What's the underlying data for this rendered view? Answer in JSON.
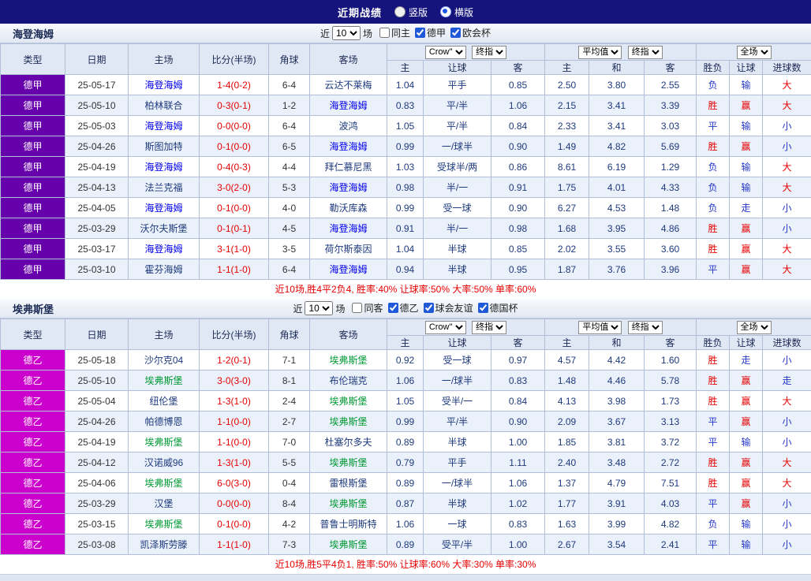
{
  "topbar": {
    "title": "近期战绩",
    "radios": [
      {
        "label": "竖版",
        "selected": false
      },
      {
        "label": "横版",
        "selected": true
      }
    ]
  },
  "labels": {
    "near": "近",
    "games": "场"
  },
  "columns": [
    "类型",
    "日期",
    "主场",
    "比分(半场)",
    "角球",
    "客场",
    "主",
    "让球",
    "客",
    "主",
    "和",
    "客",
    "胜负",
    "让球",
    "进球数"
  ],
  "selects": {
    "company": "Crow\"",
    "final_index": "终指",
    "average": "平均值",
    "scope": "全场"
  },
  "sections": [
    {
      "team": "海登海姆",
      "team_color": "#0000ee",
      "league_color": "#6600aa",
      "games_count": "10",
      "filters": [
        {
          "label": "同主",
          "checked": false
        },
        {
          "label": "德甲",
          "checked": true
        },
        {
          "label": "欧会杯",
          "checked": true
        }
      ],
      "rows": [
        {
          "league": "德甲",
          "date": "25-05-17",
          "home": "海登海姆",
          "focus": "home",
          "score": "1-4(0-2)",
          "corners": "6-4",
          "away": "云达不莱梅",
          "ah_home": "1.04",
          "ah_line": "平手",
          "ah_away": "0.85",
          "eu_home": "2.50",
          "eu_draw": "3.80",
          "eu_away": "2.55",
          "outcome": "负",
          "outcome_red": false,
          "ah_result": "输",
          "ah_result_red": false,
          "ou_result": "大",
          "ou_result_red": true
        },
        {
          "league": "德甲",
          "date": "25-05-10",
          "home": "柏林联合",
          "focus": "away",
          "score": "0-3(0-1)",
          "corners": "1-2",
          "away": "海登海姆",
          "ah_home": "0.83",
          "ah_line": "平/半",
          "ah_away": "1.06",
          "eu_home": "2.15",
          "eu_draw": "3.41",
          "eu_away": "3.39",
          "outcome": "胜",
          "outcome_red": true,
          "ah_result": "赢",
          "ah_result_red": true,
          "ou_result": "大",
          "ou_result_red": true
        },
        {
          "league": "德甲",
          "date": "25-05-03",
          "home": "海登海姆",
          "focus": "home",
          "score": "0-0(0-0)",
          "corners": "6-4",
          "away": "波鸿",
          "ah_home": "1.05",
          "ah_line": "平/半",
          "ah_away": "0.84",
          "eu_home": "2.33",
          "eu_draw": "3.41",
          "eu_away": "3.03",
          "outcome": "平",
          "outcome_red": false,
          "ah_result": "输",
          "ah_result_red": false,
          "ou_result": "小",
          "ou_result_red": false
        },
        {
          "league": "德甲",
          "date": "25-04-26",
          "home": "斯图加特",
          "focus": "away",
          "score": "0-1(0-0)",
          "corners": "6-5",
          "away": "海登海姆",
          "ah_home": "0.99",
          "ah_line": "一/球半",
          "ah_away": "0.90",
          "eu_home": "1.49",
          "eu_draw": "4.82",
          "eu_away": "5.69",
          "outcome": "胜",
          "outcome_red": true,
          "ah_result": "赢",
          "ah_result_red": true,
          "ou_result": "小",
          "ou_result_red": false
        },
        {
          "league": "德甲",
          "date": "25-04-19",
          "home": "海登海姆",
          "focus": "home",
          "score": "0-4(0-3)",
          "corners": "4-4",
          "away": "拜仁慕尼黑",
          "ah_home": "1.03",
          "ah_line": "受球半/两",
          "ah_away": "0.86",
          "eu_home": "8.61",
          "eu_draw": "6.19",
          "eu_away": "1.29",
          "outcome": "负",
          "outcome_red": false,
          "ah_result": "输",
          "ah_result_red": false,
          "ou_result": "大",
          "ou_result_red": true
        },
        {
          "league": "德甲",
          "date": "25-04-13",
          "home": "法兰克福",
          "focus": "away",
          "score": "3-0(2-0)",
          "corners": "5-3",
          "away": "海登海姆",
          "ah_home": "0.98",
          "ah_line": "半/一",
          "ah_away": "0.91",
          "eu_home": "1.75",
          "eu_draw": "4.01",
          "eu_away": "4.33",
          "outcome": "负",
          "outcome_red": false,
          "ah_result": "输",
          "ah_result_red": false,
          "ou_result": "大",
          "ou_result_red": true
        },
        {
          "league": "德甲",
          "date": "25-04-05",
          "home": "海登海姆",
          "focus": "home",
          "score": "0-1(0-0)",
          "corners": "4-0",
          "away": "勒沃库森",
          "ah_home": "0.99",
          "ah_line": "受一球",
          "ah_away": "0.90",
          "eu_home": "6.27",
          "eu_draw": "4.53",
          "eu_away": "1.48",
          "outcome": "负",
          "outcome_red": false,
          "ah_result": "走",
          "ah_result_red": false,
          "ou_result": "小",
          "ou_result_red": false
        },
        {
          "league": "德甲",
          "date": "25-03-29",
          "home": "沃尔夫斯堡",
          "focus": "away",
          "score": "0-1(0-1)",
          "corners": "4-5",
          "away": "海登海姆",
          "ah_home": "0.91",
          "ah_line": "半/一",
          "ah_away": "0.98",
          "eu_home": "1.68",
          "eu_draw": "3.95",
          "eu_away": "4.86",
          "outcome": "胜",
          "outcome_red": true,
          "ah_result": "赢",
          "ah_result_red": true,
          "ou_result": "小",
          "ou_result_red": false
        },
        {
          "league": "德甲",
          "date": "25-03-17",
          "home": "海登海姆",
          "focus": "home",
          "score": "3-1(1-0)",
          "corners": "3-5",
          "away": "荷尔斯泰因",
          "ah_home": "1.04",
          "ah_line": "半球",
          "ah_away": "0.85",
          "eu_home": "2.02",
          "eu_draw": "3.55",
          "eu_away": "3.60",
          "outcome": "胜",
          "outcome_red": true,
          "ah_result": "赢",
          "ah_result_red": true,
          "ou_result": "大",
          "ou_result_red": true
        },
        {
          "league": "德甲",
          "date": "25-03-10",
          "home": "霍芬海姆",
          "focus": "away",
          "score": "1-1(1-0)",
          "corners": "6-4",
          "away": "海登海姆",
          "ah_home": "0.94",
          "ah_line": "半球",
          "ah_away": "0.95",
          "eu_home": "1.87",
          "eu_draw": "3.76",
          "eu_away": "3.96",
          "outcome": "平",
          "outcome_red": false,
          "ah_result": "赢",
          "ah_result_red": true,
          "ou_result": "大",
          "ou_result_red": true
        }
      ],
      "summary": "近10场,胜4平2负4, 胜率:40% 让球率:50% 大率:50% 单率:60%"
    },
    {
      "team": "埃弗斯堡",
      "team_color": "#009933",
      "league_color": "#cc00cc",
      "games_count": "10",
      "filters": [
        {
          "label": "同客",
          "checked": false
        },
        {
          "label": "德乙",
          "checked": true
        },
        {
          "label": "球会友谊",
          "checked": true
        },
        {
          "label": "德国杯",
          "checked": true
        }
      ],
      "rows": [
        {
          "league": "德乙",
          "date": "25-05-18",
          "home": "沙尔克04",
          "focus": "away",
          "score": "1-2(0-1)",
          "corners": "7-1",
          "away": "埃弗斯堡",
          "ah_home": "0.92",
          "ah_line": "受一球",
          "ah_away": "0.97",
          "eu_home": "4.57",
          "eu_draw": "4.42",
          "eu_away": "1.60",
          "outcome": "胜",
          "outcome_red": true,
          "ah_result": "走",
          "ah_result_red": false,
          "ou_result": "小",
          "ou_result_red": false
        },
        {
          "league": "德乙",
          "date": "25-05-10",
          "home": "埃弗斯堡",
          "focus": "home",
          "score": "3-0(3-0)",
          "corners": "8-1",
          "away": "布伦瑞克",
          "ah_home": "1.06",
          "ah_line": "一/球半",
          "ah_away": "0.83",
          "eu_home": "1.48",
          "eu_draw": "4.46",
          "eu_away": "5.78",
          "outcome": "胜",
          "outcome_red": true,
          "ah_result": "赢",
          "ah_result_red": true,
          "ou_result": "走",
          "ou_result_red": false
        },
        {
          "league": "德乙",
          "date": "25-05-04",
          "home": "纽伦堡",
          "focus": "away",
          "score": "1-3(1-0)",
          "corners": "2-4",
          "away": "埃弗斯堡",
          "ah_home": "1.05",
          "ah_line": "受半/一",
          "ah_away": "0.84",
          "eu_home": "4.13",
          "eu_draw": "3.98",
          "eu_away": "1.73",
          "outcome": "胜",
          "outcome_red": true,
          "ah_result": "赢",
          "ah_result_red": true,
          "ou_result": "大",
          "ou_result_red": true
        },
        {
          "league": "德乙",
          "date": "25-04-26",
          "home": "帕德博恩",
          "focus": "away",
          "score": "1-1(0-0)",
          "corners": "2-7",
          "away": "埃弗斯堡",
          "ah_home": "0.99",
          "ah_line": "平/半",
          "ah_away": "0.90",
          "eu_home": "2.09",
          "eu_draw": "3.67",
          "eu_away": "3.13",
          "outcome": "平",
          "outcome_red": false,
          "ah_result": "赢",
          "ah_result_red": true,
          "ou_result": "小",
          "ou_result_red": false
        },
        {
          "league": "德乙",
          "date": "25-04-19",
          "home": "埃弗斯堡",
          "focus": "home",
          "score": "1-1(0-0)",
          "corners": "7-0",
          "away": "杜塞尔多夫",
          "ah_home": "0.89",
          "ah_line": "半球",
          "ah_away": "1.00",
          "eu_home": "1.85",
          "eu_draw": "3.81",
          "eu_away": "3.72",
          "outcome": "平",
          "outcome_red": false,
          "ah_result": "输",
          "ah_result_red": false,
          "ou_result": "小",
          "ou_result_red": false
        },
        {
          "league": "德乙",
          "date": "25-04-12",
          "home": "汉诺威96",
          "focus": "away",
          "score": "1-3(1-0)",
          "corners": "5-5",
          "away": "埃弗斯堡",
          "ah_home": "0.79",
          "ah_line": "平手",
          "ah_away": "1.11",
          "eu_home": "2.40",
          "eu_draw": "3.48",
          "eu_away": "2.72",
          "outcome": "胜",
          "outcome_red": true,
          "ah_result": "赢",
          "ah_result_red": true,
          "ou_result": "大",
          "ou_result_red": true
        },
        {
          "league": "德乙",
          "date": "25-04-06",
          "home": "埃弗斯堡",
          "focus": "home",
          "score": "6-0(3-0)",
          "corners": "0-4",
          "away": "雷根斯堡",
          "ah_home": "0.89",
          "ah_line": "一/球半",
          "ah_away": "1.06",
          "eu_home": "1.37",
          "eu_draw": "4.79",
          "eu_away": "7.51",
          "outcome": "胜",
          "outcome_red": true,
          "ah_result": "赢",
          "ah_result_red": true,
          "ou_result": "大",
          "ou_result_red": true
        },
        {
          "league": "德乙",
          "date": "25-03-29",
          "home": "汉堡",
          "focus": "away",
          "score": "0-0(0-0)",
          "corners": "8-4",
          "away": "埃弗斯堡",
          "ah_home": "0.87",
          "ah_line": "半球",
          "ah_away": "1.02",
          "eu_home": "1.77",
          "eu_draw": "3.91",
          "eu_away": "4.03",
          "outcome": "平",
          "outcome_red": false,
          "ah_result": "赢",
          "ah_result_red": true,
          "ou_result": "小",
          "ou_result_red": false
        },
        {
          "league": "德乙",
          "date": "25-03-15",
          "home": "埃弗斯堡",
          "focus": "home",
          "score": "0-1(0-0)",
          "corners": "4-2",
          "away": "普鲁士明斯特",
          "ah_home": "1.06",
          "ah_line": "一球",
          "ah_away": "0.83",
          "eu_home": "1.63",
          "eu_draw": "3.99",
          "eu_away": "4.82",
          "outcome": "负",
          "outcome_red": false,
          "ah_result": "输",
          "ah_result_red": false,
          "ou_result": "小",
          "ou_result_red": false
        },
        {
          "league": "德乙",
          "date": "25-03-08",
          "home": "凯泽斯劳滕",
          "focus": "away",
          "score": "1-1(1-0)",
          "corners": "7-3",
          "away": "埃弗斯堡",
          "ah_home": "0.89",
          "ah_line": "受平/半",
          "ah_away": "1.00",
          "eu_home": "2.67",
          "eu_draw": "3.54",
          "eu_away": "2.41",
          "outcome": "平",
          "outcome_red": false,
          "ah_result": "输",
          "ah_result_red": false,
          "ou_result": "小",
          "ou_result_red": false
        }
      ],
      "summary": "近10场,胜5平4负1, 胜率:50% 让球率:60% 大率:30% 单率:30%"
    }
  ]
}
